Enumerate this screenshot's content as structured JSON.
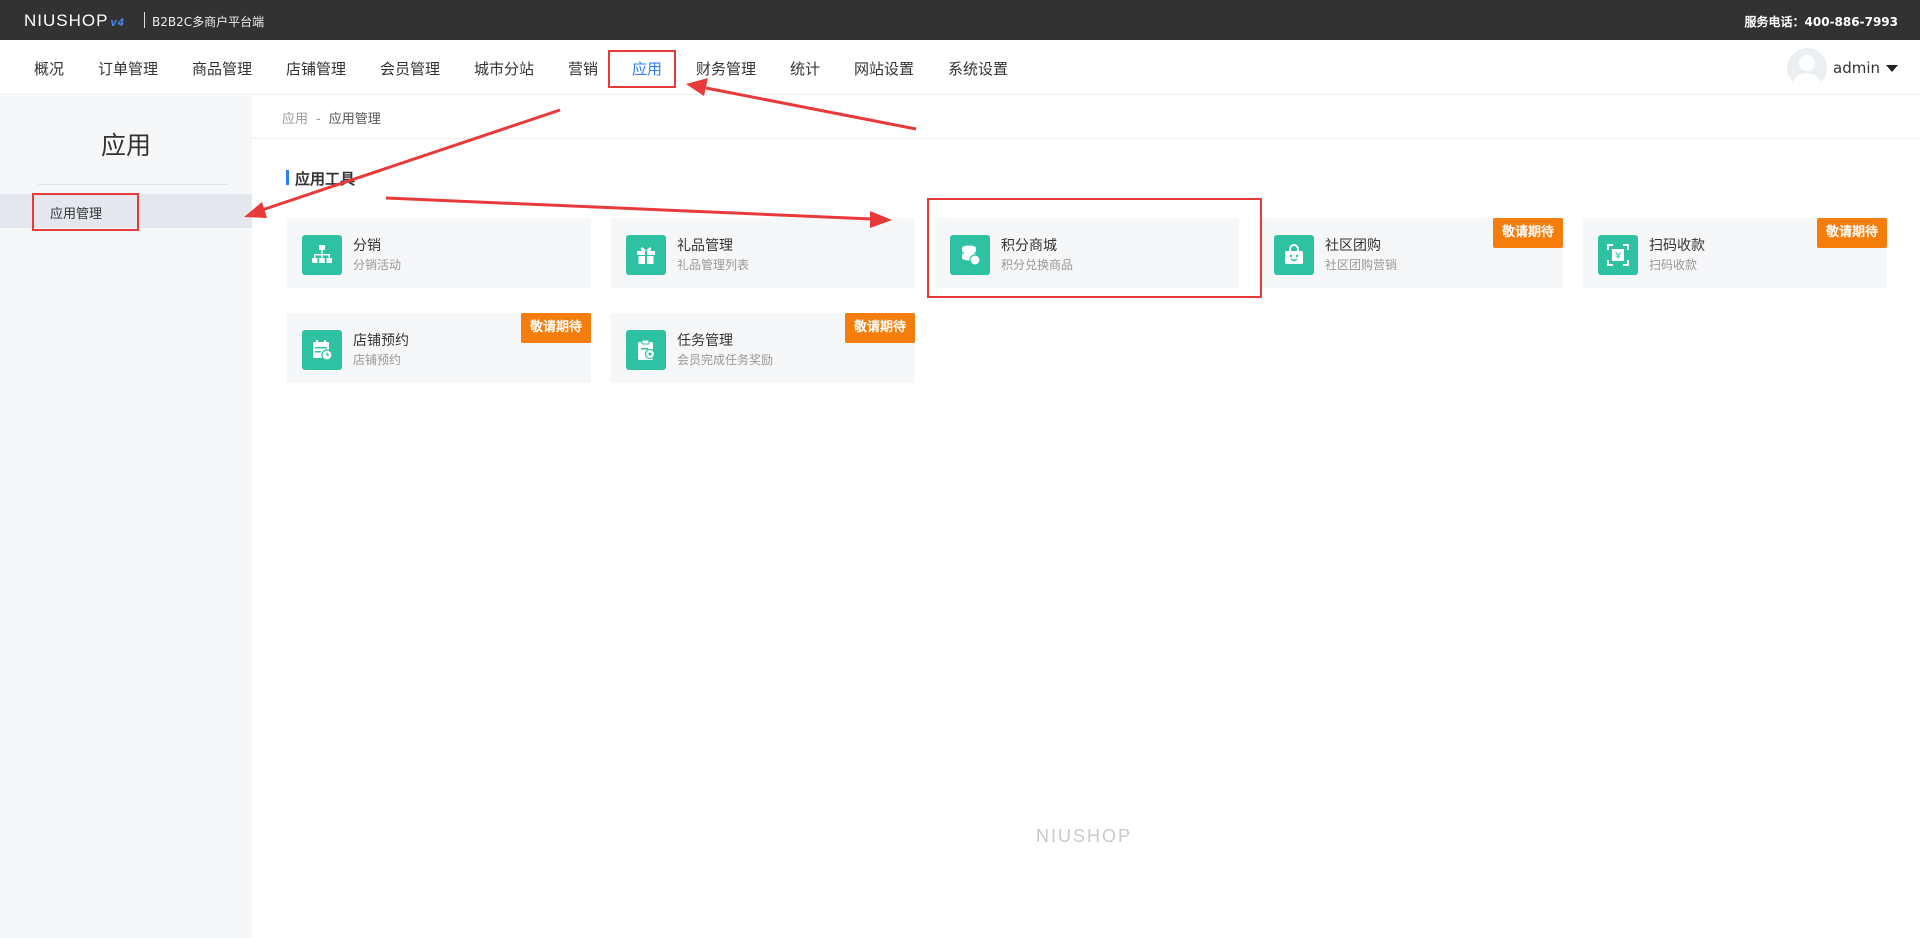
{
  "header": {
    "logo": "NIUSHOP",
    "logo_version": "v4",
    "subtitle": "B2B2C多商户平台端",
    "service_phone": "服务电话：400-886-7993"
  },
  "nav": {
    "items": [
      {
        "label": "概况"
      },
      {
        "label": "订单管理"
      },
      {
        "label": "商品管理"
      },
      {
        "label": "店铺管理"
      },
      {
        "label": "会员管理"
      },
      {
        "label": "城市分站"
      },
      {
        "label": "营销"
      },
      {
        "label": "应用"
      },
      {
        "label": "财务管理"
      },
      {
        "label": "统计"
      },
      {
        "label": "网站设置"
      },
      {
        "label": "系统设置"
      }
    ],
    "active_index": 7,
    "user_name": "admin"
  },
  "sidebar": {
    "title": "应用",
    "items": [
      {
        "label": "应用管理"
      }
    ]
  },
  "breadcrumb": {
    "root": "应用",
    "separator": "-",
    "current": "应用管理"
  },
  "section": {
    "title": "应用工具"
  },
  "cards": [
    {
      "title": "分销",
      "desc": "分销活动",
      "icon": "org-chart-icon",
      "badge": ""
    },
    {
      "title": "礼品管理",
      "desc": "礼品管理列表",
      "icon": "gift-icon",
      "badge": ""
    },
    {
      "title": "积分商城",
      "desc": "积分兑换商品",
      "icon": "coins-icon",
      "badge": ""
    },
    {
      "title": "社区团购",
      "desc": "社区团购营销",
      "icon": "shopping-bag-icon",
      "badge": "敬请期待"
    },
    {
      "title": "扫码收款",
      "desc": "扫码收款",
      "icon": "scan-pay-icon",
      "badge": "敬请期待"
    },
    {
      "title": "店铺预约",
      "desc": "店铺预约",
      "icon": "calendar-icon",
      "badge": "敬请期待"
    },
    {
      "title": "任务管理",
      "desc": "会员完成任务奖励",
      "icon": "clipboard-task-icon",
      "badge": "敬请期待"
    }
  ],
  "footer": {
    "logo": "NIUSHOP"
  },
  "colors": {
    "accent": "#2d7df6",
    "icon_bg": "#2ec2a2",
    "badge": "#f57d0c",
    "annotation": "#e83a3a",
    "topbar": "#323232"
  }
}
